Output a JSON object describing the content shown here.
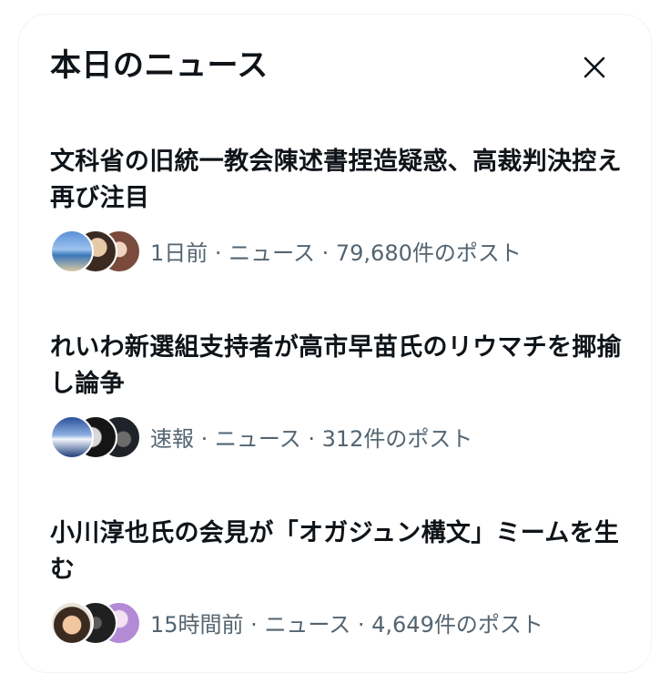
{
  "header": {
    "title": "本日のニュース"
  },
  "items": [
    {
      "headline": "文科省の旧統一教会陳述書捏造疑惑、高裁判決控え再び注目",
      "time": "1日前",
      "category": "ニュース",
      "posts": "79,680件のポスト"
    },
    {
      "headline": "れいわ新選組支持者が高市早苗氏のリウマチを揶揄し論争",
      "time": "速報",
      "category": "ニュース",
      "posts": "312件のポスト"
    },
    {
      "headline": "小川淳也氏の会見が「オガジュン構文」ミームを生む",
      "time": "15時間前",
      "category": "ニュース",
      "posts": "4,649件のポスト"
    }
  ],
  "separator": " · ",
  "colors": {
    "text": "#0f1419",
    "secondary": "#536471",
    "border": "#eff3f4"
  }
}
